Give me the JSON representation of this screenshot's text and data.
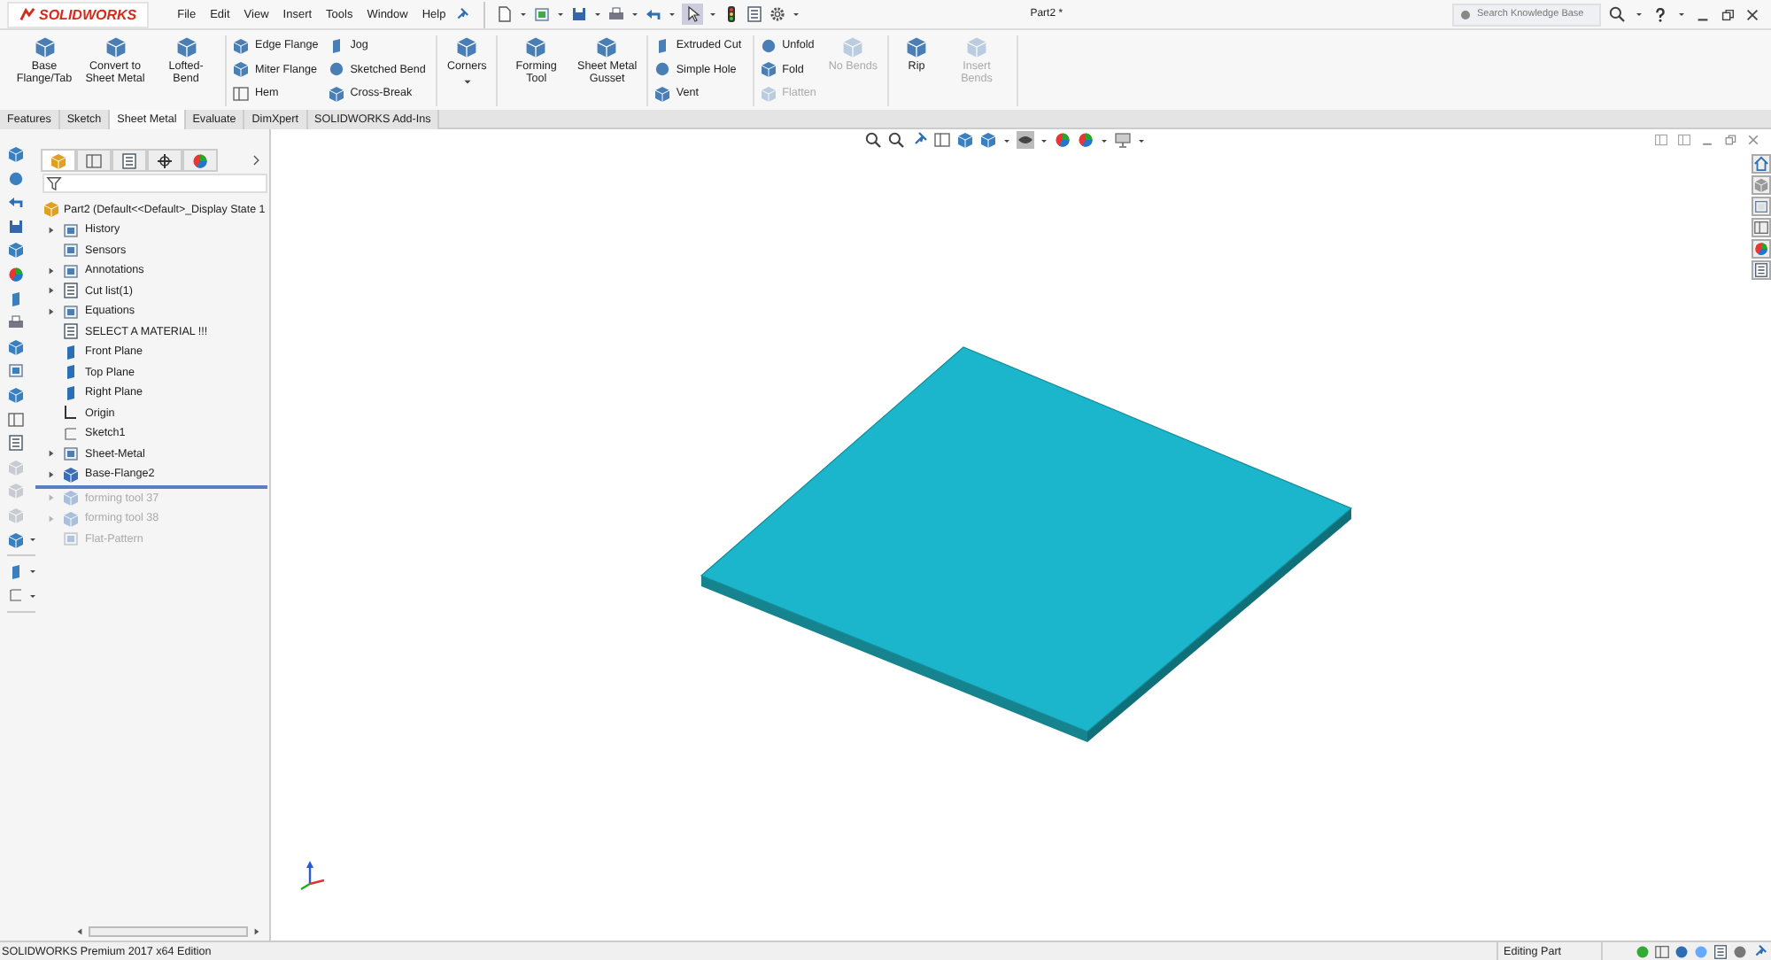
{
  "window": {
    "logo": "SOLIDWORKS",
    "title": "Part2 *"
  },
  "menu": [
    "File",
    "Edit",
    "View",
    "Insert",
    "Tools",
    "Window",
    "Help"
  ],
  "search": {
    "placeholder": "Search Knowledge Base"
  },
  "ribbon": {
    "groups": [
      {
        "items": [
          {
            "kind": "large",
            "label": "Base Flange/Tab",
            "disabled": false
          },
          {
            "kind": "large",
            "label": "Convert to Sheet Metal",
            "disabled": false
          },
          {
            "kind": "large",
            "label": "Lofted-Bend",
            "disabled": false
          }
        ]
      },
      {
        "items": [
          {
            "kind": "small",
            "label": "Edge Flange",
            "disabled": false
          },
          {
            "kind": "small",
            "label": "Miter Flange",
            "disabled": false
          },
          {
            "kind": "small",
            "label": "Hem",
            "disabled": false
          },
          {
            "kind": "small",
            "label": "Jog",
            "disabled": false
          },
          {
            "kind": "small",
            "label": "Sketched Bend",
            "disabled": false
          },
          {
            "kind": "small",
            "label": "Cross-Break",
            "disabled": false
          }
        ]
      },
      {
        "items": [
          {
            "kind": "large",
            "label": "Corners",
            "disabled": false,
            "dropdown": true
          }
        ]
      },
      {
        "items": [
          {
            "kind": "large",
            "label": "Forming Tool",
            "disabled": false
          },
          {
            "kind": "large",
            "label": "Sheet Metal Gusset",
            "disabled": false
          }
        ]
      },
      {
        "items": [
          {
            "kind": "small",
            "label": "Extruded Cut",
            "disabled": false
          },
          {
            "kind": "small",
            "label": "Simple Hole",
            "disabled": false
          },
          {
            "kind": "small",
            "label": "Vent",
            "disabled": false
          }
        ]
      },
      {
        "items": [
          {
            "kind": "small",
            "label": "Unfold",
            "disabled": false
          },
          {
            "kind": "small",
            "label": "Fold",
            "disabled": false
          },
          {
            "kind": "small",
            "label": "Flatten",
            "disabled": true
          },
          {
            "kind": "large",
            "label": "No Bends",
            "disabled": true
          }
        ]
      },
      {
        "items": [
          {
            "kind": "large",
            "label": "Rip",
            "disabled": false
          },
          {
            "kind": "large",
            "label": "Insert Bends",
            "disabled": true
          }
        ]
      }
    ]
  },
  "tabs": [
    {
      "label": "Features",
      "selected": false
    },
    {
      "label": "Sketch",
      "selected": false
    },
    {
      "label": "Sheet Metal",
      "selected": true
    },
    {
      "label": "Evaluate",
      "selected": false
    },
    {
      "label": "DimXpert",
      "selected": false
    },
    {
      "label": "SOLIDWORKS Add-Ins",
      "selected": false
    }
  ],
  "tree": {
    "root": "Part2  (Default<<Default>_Display State 1",
    "items": [
      {
        "kind": "folder",
        "label": "History",
        "expandable": true,
        "disabled": false,
        "rollback_below": false
      },
      {
        "kind": "folder",
        "label": "Sensors",
        "expandable": false,
        "disabled": false,
        "rollback_below": false
      },
      {
        "kind": "folder",
        "label": "Annotations",
        "expandable": true,
        "disabled": false,
        "rollback_below": false
      },
      {
        "kind": "list",
        "label": "Cut list(1)",
        "expandable": true,
        "disabled": false,
        "rollback_below": false
      },
      {
        "kind": "folder",
        "label": "Equations",
        "expandable": true,
        "disabled": false,
        "rollback_below": false
      },
      {
        "kind": "material",
        "label": "SELECT A MATERIAL !!!",
        "expandable": false,
        "disabled": false,
        "rollback_below": false
      },
      {
        "kind": "plane",
        "label": "Front Plane",
        "expandable": false,
        "disabled": false,
        "rollback_below": false
      },
      {
        "kind": "plane",
        "label": "Top Plane",
        "expandable": false,
        "disabled": false,
        "rollback_below": false
      },
      {
        "kind": "plane",
        "label": "Right Plane",
        "expandable": false,
        "disabled": false,
        "rollback_below": false
      },
      {
        "kind": "origin",
        "label": "Origin",
        "expandable": false,
        "disabled": false,
        "rollback_below": false
      },
      {
        "kind": "sketch",
        "label": "Sketch1",
        "expandable": false,
        "disabled": false,
        "rollback_below": false
      },
      {
        "kind": "folder",
        "label": "Sheet-Metal",
        "expandable": true,
        "disabled": false,
        "rollback_below": false
      },
      {
        "kind": "feature",
        "label": "Base-Flange2",
        "expandable": true,
        "disabled": false,
        "rollback_below": true
      },
      {
        "kind": "feature",
        "label": "forming tool 37",
        "expandable": true,
        "disabled": true,
        "rollback_below": false
      },
      {
        "kind": "feature",
        "label": "forming tool 38",
        "expandable": true,
        "disabled": true,
        "rollback_below": false
      },
      {
        "kind": "folder",
        "label": "Flat-Pattern",
        "expandable": false,
        "disabled": true,
        "rollback_below": false
      }
    ]
  },
  "status_bar": {
    "edition": "SOLIDWORKS Premium 2017 x64 Edition",
    "mode": "Editing Part"
  }
}
